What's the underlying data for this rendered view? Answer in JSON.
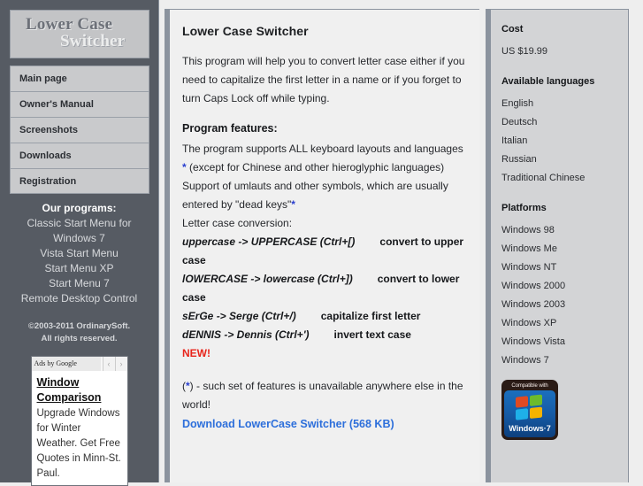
{
  "site": {
    "logo_line1": "Lower Case",
    "logo_line2": "Switcher"
  },
  "sidebar": {
    "nav": [
      {
        "label": "Main page"
      },
      {
        "label": "Owner's Manual"
      },
      {
        "label": "Screenshots"
      },
      {
        "label": "Downloads"
      },
      {
        "label": "Registration"
      }
    ],
    "programs_title": "Our programs:",
    "programs": [
      {
        "label": "Classic Start Menu for"
      },
      {
        "label": "Windows 7"
      },
      {
        "label": "Vista Start Menu"
      },
      {
        "label": "Start Menu XP"
      },
      {
        "label": "Start Menu 7"
      },
      {
        "label": "Remote Desktop Control"
      }
    ],
    "copyright_line1": "©2003-2011 OrdinarySoft.",
    "copyright_line2": "All rights reserved.",
    "ad": {
      "provider": "Ads by Google",
      "prev_arrow": "‹",
      "next_arrow": "›",
      "title": "Window Comparison",
      "body": "Upgrade Windows for Winter Weather. Get Free Quotes in Minn-St. Paul."
    }
  },
  "main": {
    "title": "Lower Case Switcher",
    "intro": "This program will help you to convert letter case either if you need to capitalize the first letter in a name or if you forget to turn Caps Lock off while typing.",
    "features_heading": "Program features:",
    "feature1_a": "The program supports ALL keyboard layouts and languages ",
    "feature1_star": "*",
    "feature1_b": " (except for Chinese and other hieroglyphic languages)",
    "feature2_a": "Support of umlauts and other symbols, which are usually entered by \"dead keys\"",
    "feature2_star": "*",
    "conversion_label": "Letter case conversion:",
    "conversions": [
      {
        "key": "uppercase -> UPPERCASE (Ctrl+[)",
        "value": "convert to upper case"
      },
      {
        "key": "lOWERCASE -> lowercase (Ctrl+])",
        "value": "convert to lower case"
      },
      {
        "key": "sErGe -> Serge (Ctrl+/)",
        "value": "capitalize first letter"
      },
      {
        "key": "dENNIS -> Dennis (Ctrl+')",
        "value": "invert text case"
      }
    ],
    "new_tag": "NEW!",
    "footnote_open": "(",
    "footnote_star": "*",
    "footnote_rest": ") - such set of features is unavailable anywhere else in the world!",
    "download_link": "Download LowerCase Switcher (568 KB)"
  },
  "right": {
    "cost_heading": "Cost",
    "cost_value": "US $19.99",
    "languages_heading": "Available languages",
    "languages": [
      {
        "label": "English"
      },
      {
        "label": "Deutsch"
      },
      {
        "label": "Italian"
      },
      {
        "label": "Russian"
      },
      {
        "label": "Traditional Chinese"
      }
    ],
    "platforms_heading": "Platforms",
    "platforms": [
      {
        "label": "Windows 98"
      },
      {
        "label": "Windows Me"
      },
      {
        "label": "Windows NT"
      },
      {
        "label": "Windows 2000"
      },
      {
        "label": "Windows 2003"
      },
      {
        "label": "Windows XP"
      },
      {
        "label": "Windows Vista"
      },
      {
        "label": "Windows 7"
      }
    ],
    "badge": {
      "top_text": "Compatible with",
      "bottom_text": "Windows·7"
    }
  },
  "colors": {
    "sidebar_bg": "#565b63",
    "nav_bg": "#c9cacc",
    "main_bg": "#f0f0f0",
    "right_bg": "#d3d4d6",
    "border": "#8b939e",
    "link": "#2d6fdb",
    "new_red": "#e8251c",
    "star_blue": "#2a3fd0"
  }
}
